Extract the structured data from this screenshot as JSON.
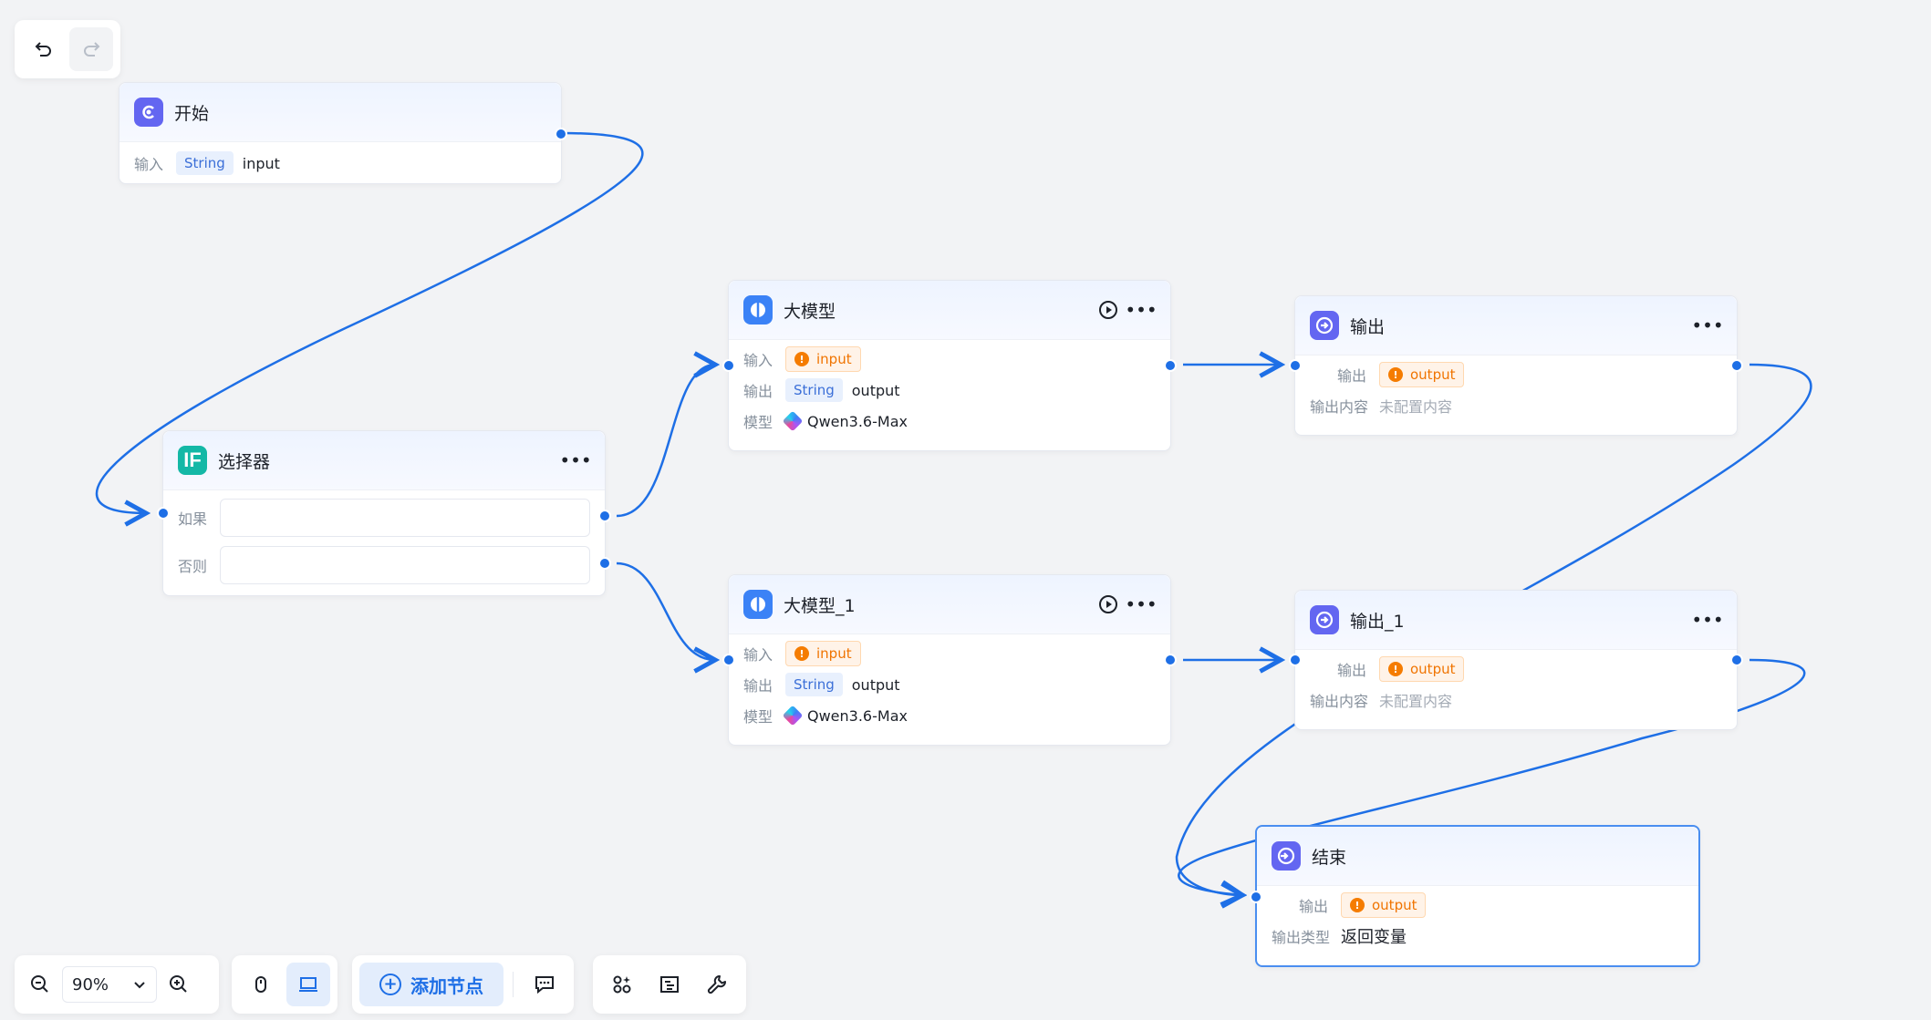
{
  "toolbar_top": {
    "undo_icon": "undo-icon",
    "redo_icon": "redo-icon"
  },
  "nodes": {
    "start": {
      "title": "开始",
      "input_label": "输入",
      "input_type": "String",
      "input_name": "input"
    },
    "selector": {
      "title": "选择器",
      "if_label": "如果",
      "else_label": "否则"
    },
    "llm": {
      "title": "大模型",
      "input_label": "输入",
      "input_var": "input",
      "output_label": "输出",
      "output_type": "String",
      "output_name": "output",
      "model_label": "模型",
      "model_name": "Qwen3.6-Max"
    },
    "llm_1": {
      "title": "大模型_1",
      "input_label": "输入",
      "input_var": "input",
      "output_label": "输出",
      "output_type": "String",
      "output_name": "output",
      "model_label": "模型",
      "model_name": "Qwen3.6-Max"
    },
    "output": {
      "title": "输出",
      "output_label": "输出",
      "output_var": "output",
      "content_label": "输出内容",
      "content_value": "未配置内容"
    },
    "output_1": {
      "title": "输出_1",
      "output_label": "输出",
      "output_var": "output",
      "content_label": "输出内容",
      "content_value": "未配置内容"
    },
    "end": {
      "title": "结束",
      "output_label": "输出",
      "output_var": "output",
      "type_label": "输出类型",
      "type_value": "返回变量"
    }
  },
  "toolbar_bottom": {
    "zoom_value": "90%",
    "add_node_label": "添加节点"
  },
  "colors": {
    "edge": "#1e6fe6",
    "accent": "#1e6fe6",
    "warning": "#f57c00"
  }
}
